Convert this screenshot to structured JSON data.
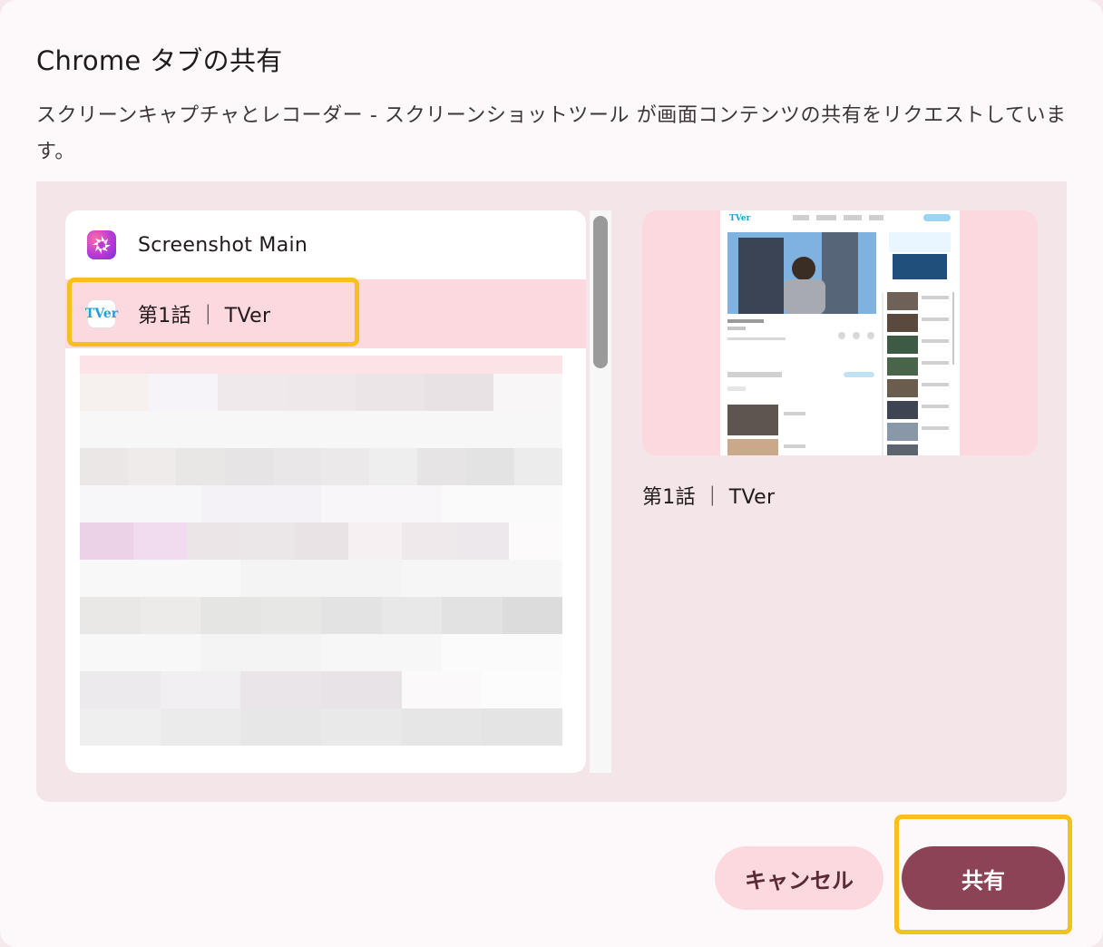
{
  "dialog": {
    "title": "Chrome タブの共有",
    "description": "スクリーンキャプチャとレコーダー - スクリーンショットツール が画面コンテンツの共有をリクエストしています。"
  },
  "tab_list": {
    "items": [
      {
        "label": "Screenshot Main",
        "icon": "screenshot-app-icon"
      },
      {
        "label": "第1話 ｜ TVer",
        "icon": "tver-icon",
        "favicon_text": "TVer",
        "selected": true
      }
    ]
  },
  "preview": {
    "caption": "第1話 ｜ TVer"
  },
  "buttons": {
    "cancel": "キャンセル",
    "share": "共有"
  },
  "colors": {
    "highlight": "#f6c11c",
    "selected_row": "#fcd9df",
    "share_button": "#8c4356",
    "cancel_button": "#fcd9df"
  }
}
